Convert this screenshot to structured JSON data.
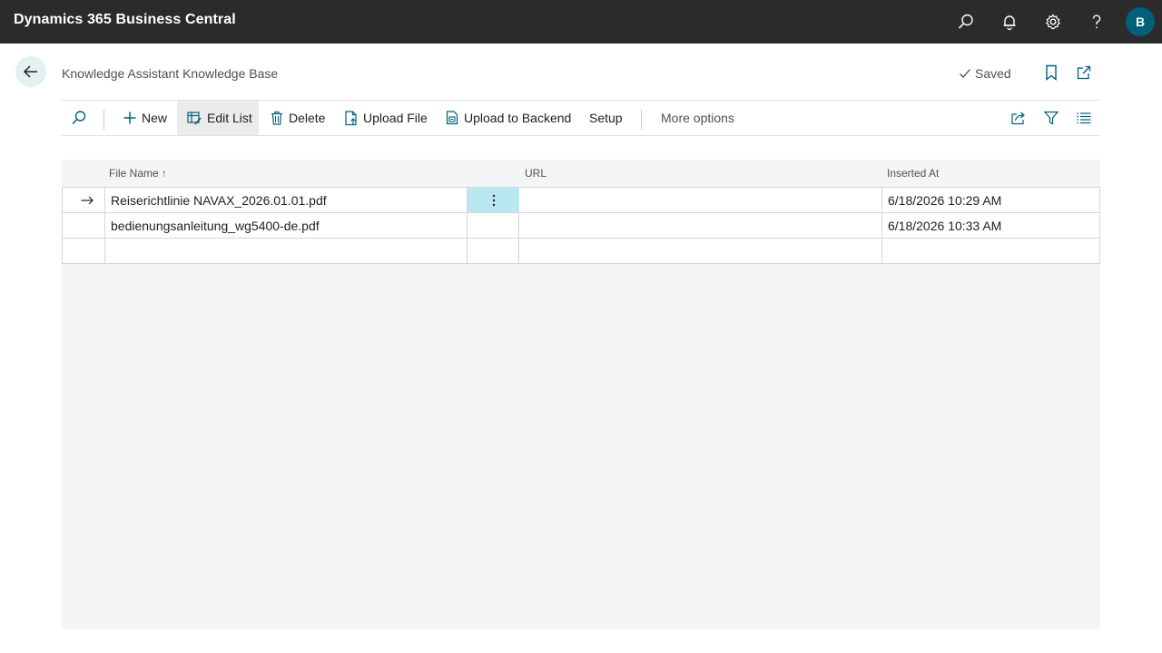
{
  "app": {
    "title": "Dynamics 365 Business Central",
    "avatar_initial": "B",
    "icons": [
      "search-icon",
      "bell-icon",
      "gear-icon",
      "help-icon"
    ]
  },
  "header": {
    "page_title": "Knowledge Assistant Knowledge Base",
    "saved_label": "Saved"
  },
  "actions": {
    "new": "New",
    "edit_list": "Edit List",
    "delete": "Delete",
    "upload_file": "Upload File",
    "upload_backend": "Upload to Backend",
    "setup": "Setup",
    "more_options": "More options"
  },
  "columns": {
    "file_name": "File Name ↑",
    "url": "URL",
    "inserted_at": "Inserted At"
  },
  "rows": [
    {
      "file_name": "Reiserichtlinie NAVAX_2026.01.01.pdf",
      "url": "",
      "inserted_at": "6/18/2026 10:29 AM",
      "selected": true
    },
    {
      "file_name": "bedienungsanleitung_wg5400-de.pdf",
      "url": "",
      "inserted_at": "6/18/2026 10:33 AM",
      "selected": false
    },
    {
      "file_name": "",
      "url": "",
      "inserted_at": "",
      "selected": false
    }
  ],
  "colors": {
    "topbar": "#2b2b2b",
    "accent": "#00607a",
    "selected_cell": "#b8e7ef"
  }
}
